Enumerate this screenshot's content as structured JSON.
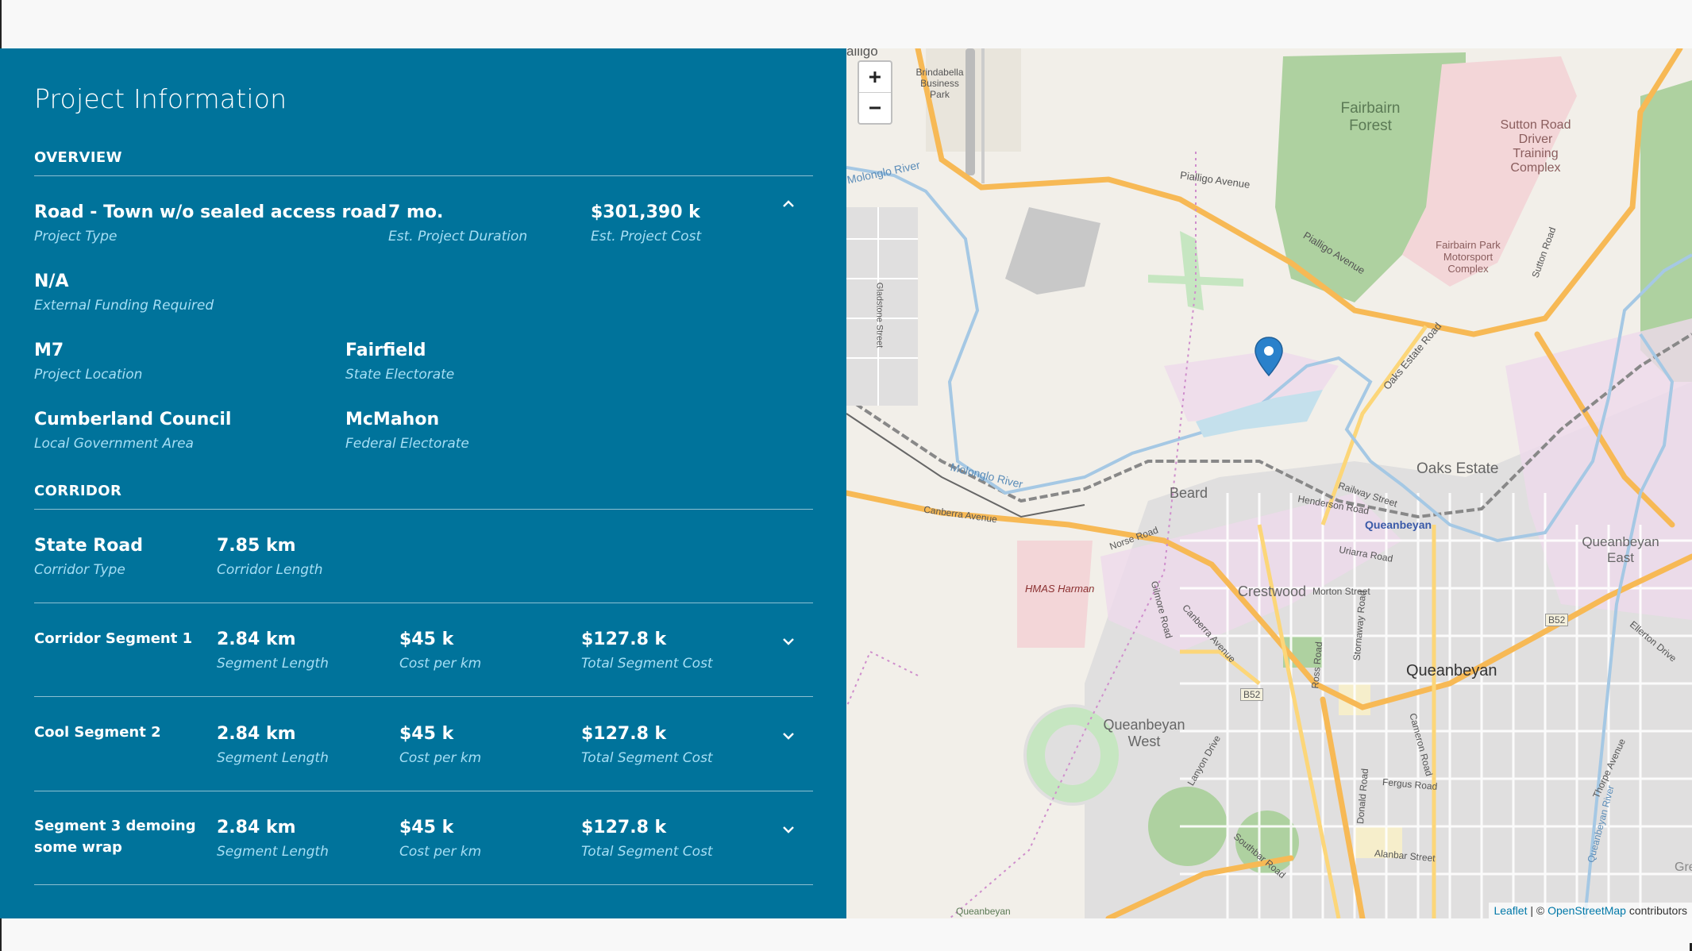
{
  "panel": {
    "title": "Project Information",
    "overview_heading": "OVERVIEW",
    "corridor_heading": "CORRIDOR",
    "overview": {
      "project_type": {
        "value": "Road - Town w/o sealed access road",
        "label": "Project Type"
      },
      "duration": {
        "value": "7 mo.",
        "label": "Est. Project Duration"
      },
      "cost": {
        "value": "$301,390 k",
        "label": "Est. Project Cost"
      },
      "funding": {
        "value": "N/A",
        "label": "External Funding Required"
      },
      "location": {
        "value": "M7",
        "label": "Project Location"
      },
      "state_electorate": {
        "value": "Fairfield",
        "label": "State Electorate"
      },
      "lga": {
        "value": "Cumberland Council",
        "label": "Local Government Area"
      },
      "federal_electorate": {
        "value": "McMahon",
        "label": "Federal Electorate"
      }
    },
    "corridor": {
      "type": {
        "value": "State Road",
        "label": "Corridor Type"
      },
      "length": {
        "value": "7.85 km",
        "label": "Corridor Length"
      }
    },
    "segments": [
      {
        "name": "Corridor Segment 1",
        "length": "2.84 km",
        "length_label": "Segment Length",
        "cost_km": "$45 k",
        "cost_km_label": "Cost per km",
        "total": "$127.8 k",
        "total_label": "Total Segment Cost"
      },
      {
        "name": "Cool Segment 2",
        "length": "2.84 km",
        "length_label": "Segment Length",
        "cost_km": "$45 k",
        "cost_km_label": "Cost per km",
        "total": "$127.8 k",
        "total_label": "Total Segment Cost"
      },
      {
        "name": "Segment 3 demoing some wrap",
        "length": "2.84 km",
        "length_label": "Segment Length",
        "cost_km": "$45 k",
        "cost_km_label": "Cost per km",
        "total": "$127.8 k",
        "total_label": "Total Segment Cost"
      }
    ],
    "icons": {
      "collapse": "chevron-up-icon",
      "expand": "chevron-down-icon"
    }
  },
  "map": {
    "zoom_in": "+",
    "zoom_out": "−",
    "attribution": {
      "leaflet": "Leaflet",
      "sep": " | © ",
      "osm": "OpenStreetMap",
      "suffix": " contributors"
    },
    "labels": {
      "fairbairn_forest": "Fairbairn Forest",
      "sutton_road": "Sutton Road Driver Training Complex",
      "fairbairn_park": "Fairbairn Park Motorsport Complex",
      "brindabella": "Brindabella Business Park",
      "pialligo": "Pialligo Avenue",
      "pialligo2": "Pialligo Avenue",
      "molonglo1": "Molonglo River",
      "molonglo2": "Molonglo River",
      "oaks_estate": "Oaks Estate",
      "oaks_estate_road": "Oaks Estate Road",
      "beard": "Beard",
      "queanbeyan_small": "Queanbeyan",
      "queanbeyan": "Queanbeyan",
      "queanbeyan_east": "Queanbeyan East",
      "queanbeyan_west": "Queanbeyan West",
      "crestwood": "Crestwood",
      "hmas_harman": "HMAS Harman",
      "canberra_avenue": "Canberra Avenue",
      "canberra_avenue2": "Canberra Avenue",
      "norse_road": "Norse Road",
      "railway_street": "Railway Street",
      "henderson_road": "Henderson Road",
      "uriarra_road": "Uriarra Road",
      "morton_street": "Morton Street",
      "b52a": "B52",
      "b52b": "B52",
      "gladstone": "Gladstone Street",
      "sutton_rd": "Sutton Road",
      "queanbeyan_bottom": "Queanbeyan",
      "gre": "Gre",
      "alanbar": "Alanbar Street",
      "fergus": "Fergus Road",
      "southbar": "Southbar Road",
      "lanyon": "Lanyon Drive",
      "gilmore": "Gilmore Road",
      "ross": "Ross Road",
      "stornaway": "Stornaway Road",
      "cameron": "Cameron Road",
      "donald": "Donald Road",
      "thorpe": "Thorpe Avenue",
      "ellerton": "Ellerton Drive",
      "queanbeyan_river": "Queanbeyan River",
      "allig": "alligo"
    },
    "icons": {
      "marker": "map-marker-icon"
    }
  }
}
